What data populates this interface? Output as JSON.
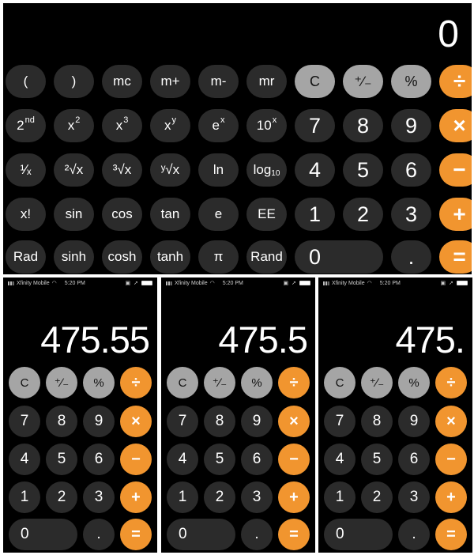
{
  "landscape": {
    "display": "0",
    "rows": [
      [
        {
          "name": "open-paren-button",
          "label": "(",
          "style": "dark"
        },
        {
          "name": "close-paren-button",
          "label": ")",
          "style": "dark"
        },
        {
          "name": "mc-button",
          "label": "mc",
          "style": "dark"
        },
        {
          "name": "m-plus-button",
          "label": "m+",
          "style": "dark"
        },
        {
          "name": "m-minus-button",
          "label": "m-",
          "style": "dark"
        },
        {
          "name": "mr-button",
          "label": "mr",
          "style": "dark"
        },
        {
          "name": "clear-button",
          "label": "C",
          "style": "light"
        },
        {
          "name": "plus-minus-button",
          "label": "⁺∕₋",
          "style": "light"
        },
        {
          "name": "percent-button",
          "label": "%",
          "style": "light"
        },
        {
          "name": "divide-button",
          "label": "÷",
          "style": "op"
        }
      ],
      [
        {
          "name": "second-button",
          "label": "2",
          "sup": "nd",
          "style": "dark"
        },
        {
          "name": "x-squared-button",
          "label": "x",
          "sup": "2",
          "style": "dark"
        },
        {
          "name": "x-cubed-button",
          "label": "x",
          "sup": "3",
          "style": "dark"
        },
        {
          "name": "x-pow-y-button",
          "label": "x",
          "sup": "y",
          "style": "dark"
        },
        {
          "name": "e-pow-x-button",
          "label": "e",
          "sup": "x",
          "style": "dark"
        },
        {
          "name": "ten-pow-x-button",
          "label": "10",
          "sup": "x",
          "style": "dark"
        },
        {
          "name": "digit-7-button",
          "label": "7",
          "style": "num"
        },
        {
          "name": "digit-8-button",
          "label": "8",
          "style": "num"
        },
        {
          "name": "digit-9-button",
          "label": "9",
          "style": "num"
        },
        {
          "name": "multiply-button",
          "label": "×",
          "style": "op"
        }
      ],
      [
        {
          "name": "reciprocal-button",
          "label": "¹∕ₓ",
          "style": "dark"
        },
        {
          "name": "square-root-button",
          "label": "²√x",
          "style": "dark"
        },
        {
          "name": "cube-root-button",
          "label": "³√x",
          "style": "dark"
        },
        {
          "name": "y-root-button",
          "label": "ʸ√x",
          "style": "dark"
        },
        {
          "name": "ln-button",
          "label": "ln",
          "style": "dark"
        },
        {
          "name": "log10-button",
          "label": "log",
          "sub": "10",
          "style": "dark"
        },
        {
          "name": "digit-4-button",
          "label": "4",
          "style": "num"
        },
        {
          "name": "digit-5-button",
          "label": "5",
          "style": "num"
        },
        {
          "name": "digit-6-button",
          "label": "6",
          "style": "num"
        },
        {
          "name": "subtract-button",
          "label": "−",
          "style": "op"
        }
      ],
      [
        {
          "name": "factorial-button",
          "label": "x!",
          "style": "dark"
        },
        {
          "name": "sin-button",
          "label": "sin",
          "style": "dark"
        },
        {
          "name": "cos-button",
          "label": "cos",
          "style": "dark"
        },
        {
          "name": "tan-button",
          "label": "tan",
          "style": "dark"
        },
        {
          "name": "e-button",
          "label": "e",
          "style": "dark"
        },
        {
          "name": "ee-button",
          "label": "EE",
          "style": "dark"
        },
        {
          "name": "digit-1-button",
          "label": "1",
          "style": "num"
        },
        {
          "name": "digit-2-button",
          "label": "2",
          "style": "num"
        },
        {
          "name": "digit-3-button",
          "label": "3",
          "style": "num"
        },
        {
          "name": "add-button",
          "label": "+",
          "style": "op"
        }
      ],
      [
        {
          "name": "rad-button",
          "label": "Rad",
          "style": "dark"
        },
        {
          "name": "sinh-button",
          "label": "sinh",
          "style": "dark"
        },
        {
          "name": "cosh-button",
          "label": "cosh",
          "style": "dark"
        },
        {
          "name": "tanh-button",
          "label": "tanh",
          "style": "dark"
        },
        {
          "name": "pi-button",
          "label": "π",
          "style": "dark"
        },
        {
          "name": "rand-button",
          "label": "Rand",
          "style": "dark"
        },
        {
          "name": "digit-0-button",
          "label": "0",
          "style": "num",
          "span": 2
        },
        {
          "name": "decimal-button",
          "label": ".",
          "style": "num"
        },
        {
          "name": "equals-button",
          "label": "=",
          "style": "op"
        }
      ]
    ]
  },
  "portrait": {
    "status": {
      "carrier": "Xfinity Mobile",
      "wifi_icon": "wifi-icon",
      "time": "5:20 PM"
    },
    "screens": [
      {
        "display": "475.55"
      },
      {
        "display": "475.5"
      },
      {
        "display": "475."
      }
    ],
    "rows": [
      [
        {
          "name": "clear-button",
          "label": "C",
          "style": "light"
        },
        {
          "name": "plus-minus-button",
          "label": "⁺∕₋",
          "style": "light"
        },
        {
          "name": "percent-button",
          "label": "%",
          "style": "light"
        },
        {
          "name": "divide-button",
          "label": "÷",
          "style": "op"
        }
      ],
      [
        {
          "name": "digit-7-button",
          "label": "7",
          "style": "num"
        },
        {
          "name": "digit-8-button",
          "label": "8",
          "style": "num"
        },
        {
          "name": "digit-9-button",
          "label": "9",
          "style": "num"
        },
        {
          "name": "multiply-button",
          "label": "×",
          "style": "op"
        }
      ],
      [
        {
          "name": "digit-4-button",
          "label": "4",
          "style": "num"
        },
        {
          "name": "digit-5-button",
          "label": "5",
          "style": "num"
        },
        {
          "name": "digit-6-button",
          "label": "6",
          "style": "num"
        },
        {
          "name": "subtract-button",
          "label": "−",
          "style": "op"
        }
      ],
      [
        {
          "name": "digit-1-button",
          "label": "1",
          "style": "num"
        },
        {
          "name": "digit-2-button",
          "label": "2",
          "style": "num"
        },
        {
          "name": "digit-3-button",
          "label": "3",
          "style": "num"
        },
        {
          "name": "add-button",
          "label": "+",
          "style": "op"
        }
      ],
      [
        {
          "name": "digit-0-button",
          "label": "0",
          "style": "num",
          "span": 2
        },
        {
          "name": "decimal-button",
          "label": ".",
          "style": "num"
        },
        {
          "name": "equals-button",
          "label": "=",
          "style": "op"
        }
      ]
    ]
  },
  "colors": {
    "operator": "#f1952f",
    "function_key": "#a5a5a5",
    "number_key": "#2b2b2b",
    "background": "#000000"
  }
}
